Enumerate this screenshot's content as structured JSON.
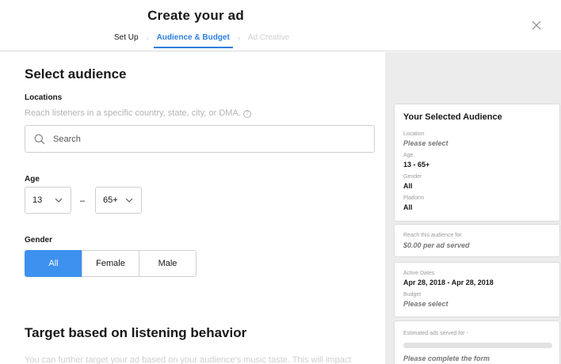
{
  "header": {
    "title": "Create your ad",
    "steps": [
      {
        "label": "Set Up",
        "state": "done"
      },
      {
        "label": "Audience & Budget",
        "state": "active"
      },
      {
        "label": "Ad Creative",
        "state": "disabled"
      }
    ],
    "close_icon": "close-icon"
  },
  "audience": {
    "heading": "Select audience",
    "locations": {
      "label": "Locations",
      "hint": "Reach listeners in a specific country, state, city, or DMA.",
      "help_icon": "?",
      "search_placeholder": "Search",
      "search_value": ""
    },
    "age": {
      "label": "Age",
      "min": "13",
      "separator": "–",
      "max": "65+"
    },
    "gender": {
      "label": "Gender",
      "options": [
        "All",
        "Female",
        "Male"
      ],
      "selected": "All"
    }
  },
  "listening": {
    "heading": "Target based on listening behavior",
    "description": "You can further target your ad based on your audience's music taste. This will impact"
  },
  "summary": {
    "selected_audience": {
      "title": "Your Selected Audience",
      "location_label": "Location",
      "location_value": "Please select",
      "age_label": "Age",
      "age_value": "13 - 65+",
      "gender_label": "Gender",
      "gender_value": "All",
      "platform_label": "Platform",
      "platform_value": "All"
    },
    "reach": {
      "label": "Reach this audience for",
      "value": "$0.00 per ad served"
    },
    "dates": {
      "active_label": "Active Dates",
      "active_value": "Apr 28, 2018 - Apr 28, 2018",
      "budget_label": "Budget",
      "budget_value": "Please select"
    },
    "estimate": {
      "label": "Estimated ads served for -",
      "progress": 0,
      "value": "Please complete the form"
    }
  },
  "colors": {
    "accent": "#3d91ef",
    "tab_active": "#2d7fe0",
    "sidebar_bg": "#ececec"
  }
}
